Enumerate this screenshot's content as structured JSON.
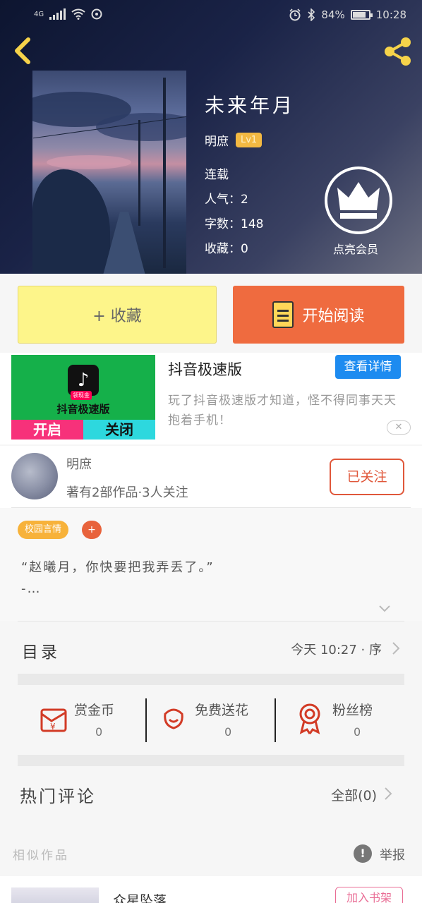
{
  "status_bar": {
    "network": "4G",
    "battery": "84%",
    "time": "10:28",
    "battery_level": 0.84
  },
  "book": {
    "title": "未来年月",
    "author": "明庶",
    "level": "Lv1",
    "status": "连载",
    "popularity": "人气：2",
    "word_count": "字数：148",
    "favorites": "收藏：0"
  },
  "vip_label": "点亮会员",
  "actions": {
    "collect": "+ 收藏",
    "read": "开始阅读"
  },
  "ad": {
    "title": "抖音极速版",
    "detail_button": "查看详情",
    "description": "玩了抖音极速版才知道，怪不得同事天天抱着手机！",
    "image_name": "抖音极速版",
    "image_tag": "领现金",
    "image_open": "开启",
    "image_close": "关闭"
  },
  "author_card": {
    "name": "明庶",
    "stats": "著有2部作品·3人关注",
    "follow_button": "已关注"
  },
  "intro": {
    "tag": "校园言情",
    "tag_add": "+",
    "text": "“赵曦月，你快要把我弄丢了。”\n-…"
  },
  "catalog": {
    "label": "目录",
    "update": "今天 10:27 · 序"
  },
  "rewards": [
    {
      "label": "赏金币",
      "count": "0"
    },
    {
      "label": "免费送花",
      "count": "0"
    },
    {
      "label": "粉丝榜",
      "count": "0"
    }
  ],
  "comments": {
    "label": "热门评论",
    "all": "全部(0)"
  },
  "similar": {
    "label": "相似作品",
    "report": "举报",
    "item_title": "众星坠落",
    "item_button": "加入书架"
  },
  "colors": {
    "accent_orange": "#ef6b3f",
    "collect_yellow": "#fdf58a",
    "reward_red": "#d23b26",
    "ad_blue": "#1d8bf0"
  }
}
